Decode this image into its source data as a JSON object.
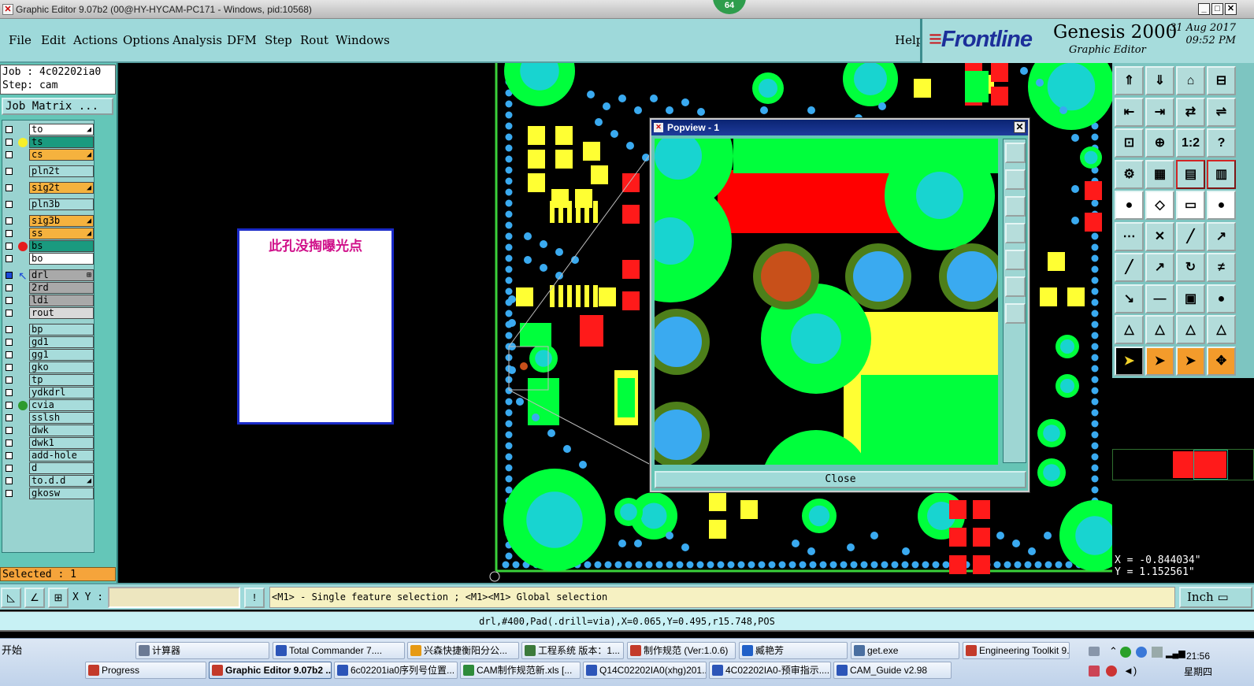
{
  "titlebar": {
    "title": "Graphic Editor 9.07b2 (00@HY-HYCAM-PC171 - Windows, pid:10568)",
    "badge": "64",
    "buttons": [
      "_",
      "□",
      "✕"
    ]
  },
  "menu": {
    "items": [
      "File",
      "Edit",
      "Actions",
      "Options",
      "Analysis",
      "DFM",
      "Step",
      "Rout",
      "Windows"
    ],
    "help": "Help"
  },
  "brand": {
    "logo": "Frontline",
    "product": "Genesis 2000",
    "subtitle": "Graphic Editor",
    "date": "31 Aug 2017",
    "time": "09:52 PM"
  },
  "job": {
    "job_line": "Job : 4c02202ia0",
    "step_line": "Step: cam",
    "matrix_button": "Job Matrix ..."
  },
  "layers": [
    {
      "name": "to",
      "color": "#ffffff",
      "indicator": "",
      "mark": "◢"
    },
    {
      "name": "ts",
      "color": "#1a9a7f",
      "indicator": "#f7ef2a",
      "mark": ""
    },
    {
      "name": "cs",
      "color": "#f5b23e",
      "indicator": "",
      "mark": "◢"
    },
    {
      "name": "pln2t",
      "color": "#a7dcdb",
      "indicator": "",
      "mark": ""
    },
    {
      "name": "sig2t",
      "color": "#f5b23e",
      "indicator": "",
      "mark": "◢"
    },
    {
      "name": "pln3b",
      "color": "#a7dcdb",
      "indicator": "",
      "mark": ""
    },
    {
      "name": "sig3b",
      "color": "#f5b23e",
      "indicator": "",
      "mark": "◢"
    },
    {
      "name": "ss",
      "color": "#f5b23e",
      "indicator": "",
      "mark": "◢"
    },
    {
      "name": "bs",
      "color": "#1a9a7f",
      "indicator": "#e51c1c",
      "mark": ""
    },
    {
      "name": "bo",
      "color": "#ffffff",
      "indicator": "",
      "mark": ""
    },
    {
      "name": "drl",
      "color": "#a9a9a9",
      "indicator": "#1c4ad9",
      "mark": "⊞"
    },
    {
      "name": "2rd",
      "color": "#a9a9a9",
      "indicator": "",
      "mark": ""
    },
    {
      "name": "ldi",
      "color": "#a9a9a9",
      "indicator": "",
      "mark": ""
    },
    {
      "name": "rout",
      "color": "#d9d9d9",
      "indicator": "",
      "mark": ""
    },
    {
      "name": "bp",
      "color": "#a7dcdb",
      "indicator": "",
      "mark": ""
    },
    {
      "name": "gd1",
      "color": "#a7dcdb",
      "indicator": "",
      "mark": ""
    },
    {
      "name": "gg1",
      "color": "#a7dcdb",
      "indicator": "",
      "mark": ""
    },
    {
      "name": "gko",
      "color": "#a7dcdb",
      "indicator": "",
      "mark": ""
    },
    {
      "name": "tp",
      "color": "#a7dcdb",
      "indicator": "",
      "mark": ""
    },
    {
      "name": "ydkdrl",
      "color": "#a7dcdb",
      "indicator": "",
      "mark": ""
    },
    {
      "name": "cvia",
      "color": "#a7dcdb",
      "indicator": "#2e9a2e",
      "mark": ""
    },
    {
      "name": "sslsh",
      "color": "#a7dcdb",
      "indicator": "",
      "mark": ""
    },
    {
      "name": "dwk",
      "color": "#a7dcdb",
      "indicator": "",
      "mark": ""
    },
    {
      "name": "dwk1",
      "color": "#a7dcdb",
      "indicator": "",
      "mark": ""
    },
    {
      "name": "add-hole",
      "color": "#a7dcdb",
      "indicator": "",
      "mark": ""
    },
    {
      "name": "d",
      "color": "#a7dcdb",
      "indicator": "",
      "mark": ""
    },
    {
      "name": "to.d.d",
      "color": "#a7dcdb",
      "indicator": "",
      "mark": "◢"
    },
    {
      "name": "gkosw",
      "color": "#a7dcdb",
      "indicator": "",
      "mark": ""
    }
  ],
  "selected": "Selected : 1",
  "note": "此孔没掏曝光点",
  "popview": {
    "title": "Popview - 1",
    "close": "Close"
  },
  "tools": {
    "icons": [
      "move-up-icon",
      "move-down-icon",
      "home-icon",
      "window-icon",
      "pan-left-icon",
      "pan-right-icon",
      "swap-icon",
      "flip-icon",
      "fit-icon",
      "center-icon",
      "scale-1-2-icon",
      "help-icon",
      "snap-icon",
      "grid-icon",
      "layer-red-icon",
      "layer-blue-icon",
      "add-pad-icon",
      "line-draw-icon",
      "measure-icon",
      "dot-icon",
      "node-icon",
      "cross-icon",
      "line-red-icon",
      "arrow-icon",
      "slash-red-icon",
      "slash-blue-icon",
      "rotate-icon",
      "ff-icon",
      "move-point-icon",
      "minus-icon",
      "box-icon",
      "dual-circle-icon",
      "tri-a-icon",
      "tri-b-icon",
      "tri-c-icon",
      "tri-d-icon",
      "pointer-icon",
      "select-orange-icon",
      "select-box-icon",
      "move-select-icon"
    ],
    "scale_label": "1:2"
  },
  "coords": {
    "x": "X = -0.844034\"",
    "y": "Y =  1.152561\""
  },
  "bottom": {
    "xy_label": "X Y :",
    "xy_value": "",
    "hint": "<M1> - Single feature selection ; <M1><M1> Global selection",
    "unit": "Inch"
  },
  "status": "drl,#400,Pad(.drill=via),X=0.065,Y=0.495,r15.748,POS",
  "taskbar": {
    "start": "开始",
    "row1": [
      {
        "label": "计算器",
        "color": "#6b7a94"
      },
      {
        "label": "Total Commander 7....",
        "color": "#2c55b8"
      },
      {
        "label": "兴森快捷衡阳分公...",
        "color": "#e69a14"
      },
      {
        "label": "工程系统 版本：1...",
        "color": "#3b7a3b"
      },
      {
        "label": "制作规范 (Ver:1.0.6)",
        "color": "#c33a2a"
      },
      {
        "label": "臧艳芳",
        "color": "#2060c8"
      },
      {
        "label": "get.exe",
        "color": "#4a6fa0"
      },
      {
        "label": "Engineering Toolkit 9....",
        "color": "#c33a2a"
      }
    ],
    "row2": [
      {
        "label": "Progress",
        "color": "#c33a2a",
        "active": false
      },
      {
        "label": "Graphic Editor 9.07b2 ...",
        "color": "#c33a2a",
        "active": true
      },
      {
        "label": "6c02201ia0序列号位置...",
        "color": "#2c55b8",
        "active": false
      },
      {
        "label": "CAM制作规范新.xls [...",
        "color": "#2e8b3a",
        "active": false
      },
      {
        "label": "Q14C02202IA0(xhg)201...",
        "color": "#2c55b8",
        "active": false
      },
      {
        "label": "4C02202IA0-预审指示....",
        "color": "#2c55b8",
        "active": false
      },
      {
        "label": "CAM_Guide v2.98",
        "color": "#2c55b8",
        "active": false
      }
    ],
    "clock_time": "21:56",
    "clock_day": "星期四"
  }
}
